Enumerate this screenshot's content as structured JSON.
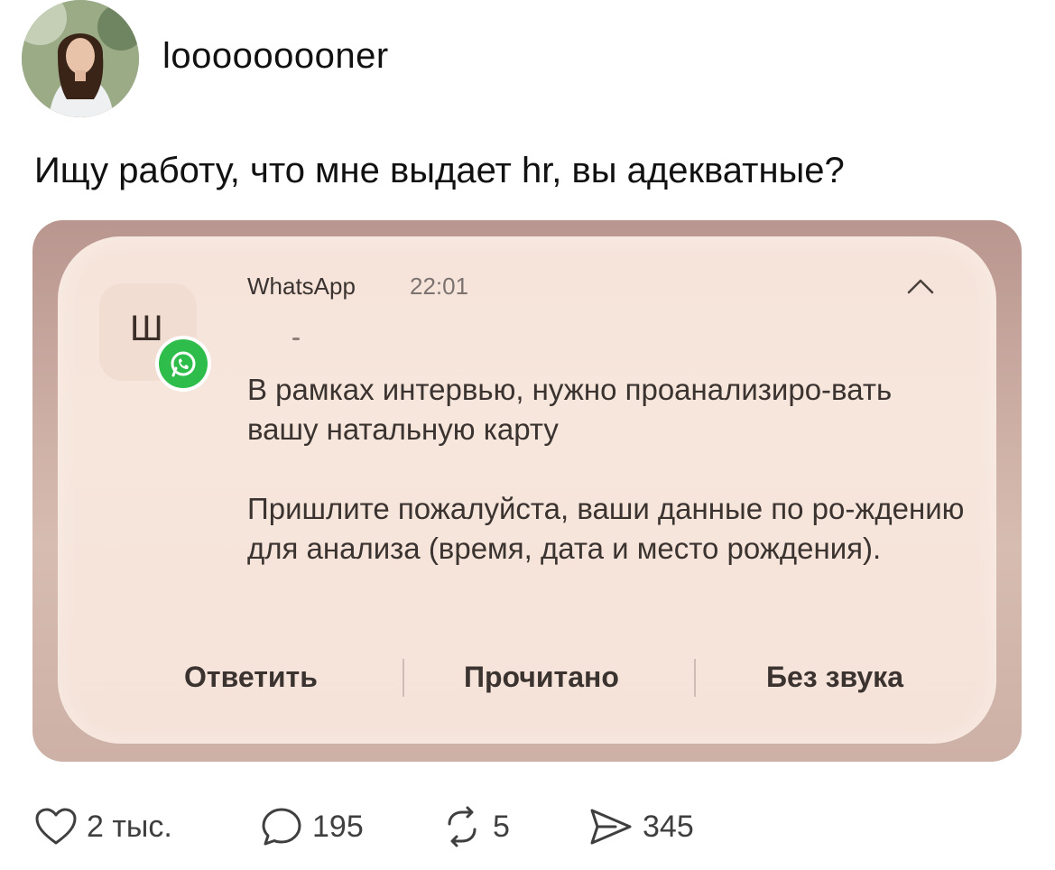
{
  "post": {
    "username": "looooooooner",
    "text": "Ищу работу, что мне выдает hr, вы адекватные?"
  },
  "notification": {
    "app_name": "WhatsApp",
    "time": "22:01",
    "icon_letter": "Ш",
    "message_paragraph_1": "В рамках интервью, нужно проанализиро-вать вашу натальную карту",
    "message_paragraph_2": "Пришлите пожалуйста, ваши данные по ро-ждению для анализа (время, дата и место рождения).",
    "actions": {
      "reply": "Ответить",
      "read": "Прочитано",
      "mute": "Без звука"
    }
  },
  "stats": {
    "likes": "2 тыс.",
    "comments": "195",
    "reposts": "5",
    "shares": "345"
  },
  "colors": {
    "whatsapp_green": "#2ebd4b",
    "notification_bg": "#f6e4da",
    "frame_bg": "#c9aaa1"
  }
}
